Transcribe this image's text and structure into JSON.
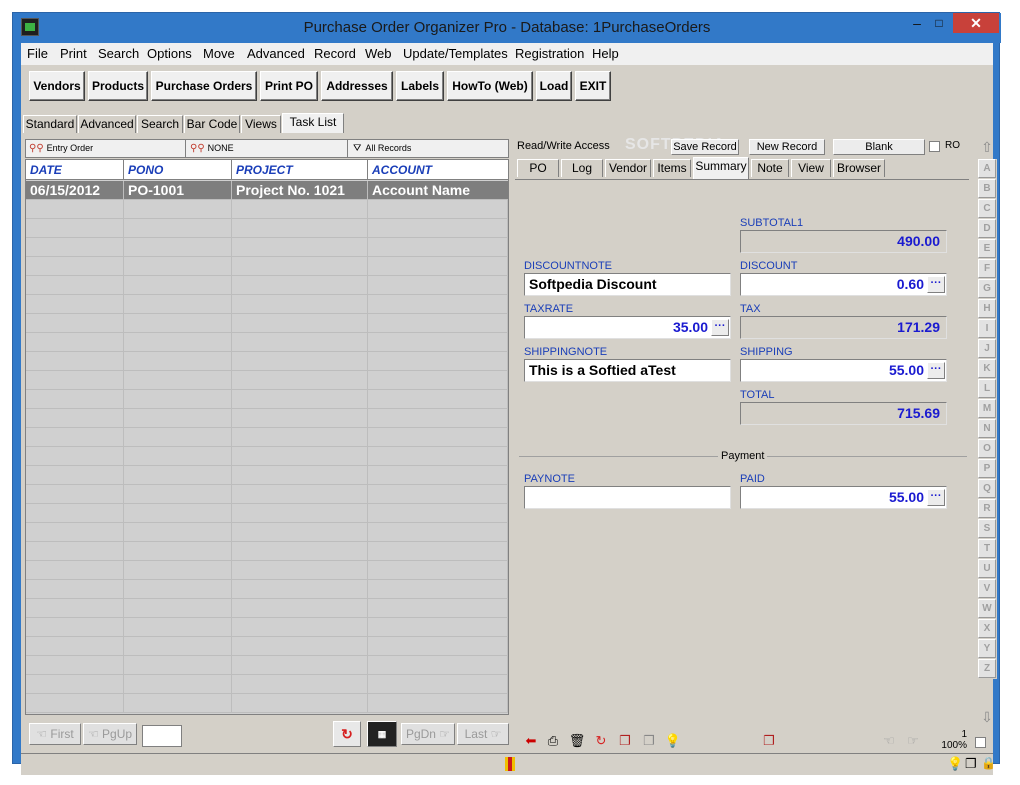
{
  "window": {
    "title": "Purchase Order Organizer Pro - Database: 1PurchaseOrders",
    "minimize_glyph": "–",
    "maximize_glyph": "□",
    "close_glyph": "✕"
  },
  "menubar": {
    "items": [
      "File",
      "Print",
      "Search",
      "Options",
      "Move",
      "Advanced",
      "Record",
      "Web",
      "Update/Templates",
      "Registration",
      "Help"
    ]
  },
  "toolbar": {
    "buttons": [
      "Vendors",
      "Products",
      "Purchase Orders",
      "Print PO",
      "Addresses",
      "Labels",
      "HowTo (Web)",
      "Load",
      "EXIT"
    ]
  },
  "view_tabs": {
    "items": [
      "Standard",
      "Advanced",
      "Search",
      "Bar Code",
      "Views",
      "Task List"
    ],
    "active": "Task List"
  },
  "left_header": {
    "entry": "Entry Order",
    "filter": "NONE",
    "scope": "All Records"
  },
  "grid": {
    "columns": [
      "DATE",
      "PONO",
      "PROJECT",
      "ACCOUNT"
    ],
    "rows": [
      [
        "06/15/2012",
        "PO-1001",
        "Project No. 1021",
        "Account Name"
      ]
    ]
  },
  "nav": {
    "first": "First",
    "pgup": "PgUp",
    "pgdn": "PgDn",
    "last": "Last"
  },
  "right_top": {
    "access": "Read/Write Access",
    "save_record": "Save Record",
    "new_record": "New Record",
    "blank": "Blank",
    "ro": "RO",
    "watermark": "SOFTPEDIA"
  },
  "record_tabs": {
    "items": [
      "PO",
      "Log",
      "Vendor",
      "Items",
      "Summary",
      "Note",
      "View",
      "Browser"
    ],
    "active": "Summary"
  },
  "summary": {
    "subtotal_label": "SUBTOTAL1",
    "subtotal": "490.00",
    "discountnote_label": "DISCOUNTNOTE",
    "discountnote": "Softpedia Discount",
    "discount_label": "DISCOUNT",
    "discount": "0.60",
    "taxrate_label": "TAXRATE",
    "taxrate": "35.00",
    "tax_label": "TAX",
    "tax": "171.29",
    "shippingnote_label": "SHIPPINGNOTE",
    "shippingnote": "This is a Softied aTest",
    "shipping_label": "SHIPPING",
    "shipping": "55.00",
    "total_label": "TOTAL",
    "total": "715.69",
    "payment_label": "Payment",
    "paynote_label": "PAYNOTE",
    "paynote": "",
    "paid_label": "PAID",
    "paid": "55.00",
    "ellipsis": "···"
  },
  "alphabet": [
    "A",
    "B",
    "C",
    "D",
    "E",
    "F",
    "G",
    "H",
    "I",
    "J",
    "K",
    "L",
    "M",
    "N",
    "O",
    "P",
    "Q",
    "R",
    "S",
    "T",
    "U",
    "V",
    "W",
    "X",
    "Y",
    "Z"
  ],
  "status": {
    "record_count": "1",
    "zoom": "100%"
  },
  "colors": {
    "titlebar": "#3279c8",
    "label_blue": "#1a3eb8",
    "number_blue": "#1a1ad0",
    "selected_row": "#7e7e7e",
    "close": "#c8413a"
  }
}
